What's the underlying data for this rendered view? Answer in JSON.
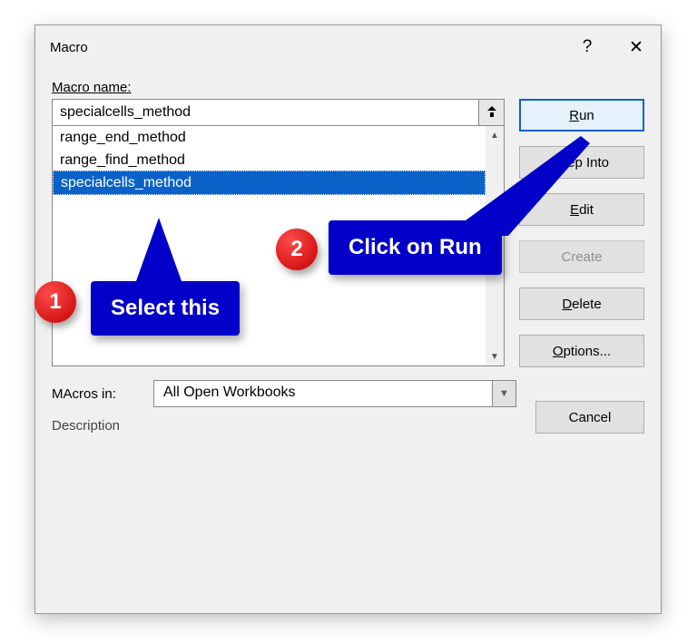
{
  "dialog": {
    "title": "Macro",
    "help": "?",
    "close": "✕"
  },
  "macro_name_label": "Macro name:",
  "macro_name_value": "specialcells_method",
  "macro_list": [
    {
      "label": "range_end_method",
      "selected": false
    },
    {
      "label": "range_find_method",
      "selected": false
    },
    {
      "label": "specialcells_method",
      "selected": true
    }
  ],
  "buttons": {
    "run": {
      "pre": "",
      "u": "R",
      "post": "un"
    },
    "stepinto": {
      "pre": "",
      "u": "S",
      "post": "tep Into"
    },
    "edit": {
      "pre": "",
      "u": "E",
      "post": "dit"
    },
    "create": {
      "text": "Create"
    },
    "delete": {
      "pre": "",
      "u": "D",
      "post": "elete"
    },
    "options": {
      "pre": "",
      "u": "O",
      "post": "ptions..."
    },
    "cancel": {
      "text": "Cancel"
    }
  },
  "macros_in": {
    "label": "Macros in:",
    "label_u": "A",
    "value": "All Open Workbooks"
  },
  "description_label": "Description",
  "annotations": {
    "badge1": "1",
    "badge2": "2",
    "callout1": "Select this",
    "callout2": "Click on Run"
  }
}
